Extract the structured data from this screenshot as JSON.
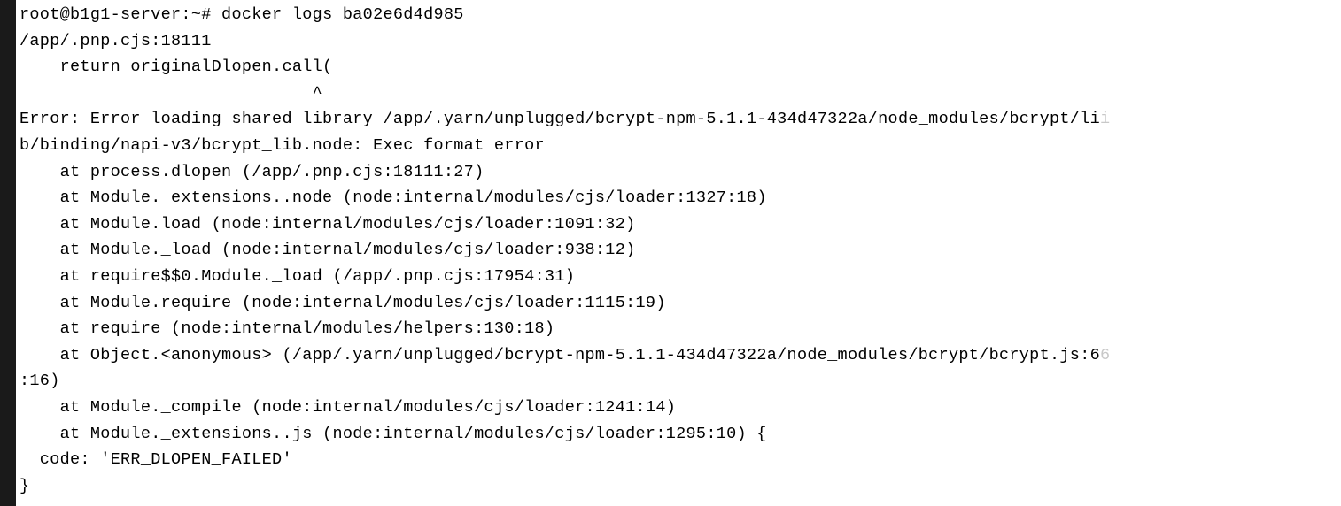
{
  "terminal": {
    "prompt": "root@b1g1-server:~# ",
    "command": "docker logs ba02e6d4d985",
    "lines": [
      "/app/.pnp.cjs:18111",
      "    return originalDlopen.call(",
      "                             ^",
      "",
      "Error: Error loading shared library /app/.yarn/unplugged/bcrypt-npm-5.1.1-434d47322a/node_modules/bcrypt/li",
      "b/binding/napi-v3/bcrypt_lib.node: Exec format error",
      "    at process.dlopen (/app/.pnp.cjs:18111:27)",
      "    at Module._extensions..node (node:internal/modules/cjs/loader:1327:18)",
      "    at Module.load (node:internal/modules/cjs/loader:1091:32)",
      "    at Module._load (node:internal/modules/cjs/loader:938:12)",
      "    at require$$0.Module._load (/app/.pnp.cjs:17954:31)",
      "    at Module.require (node:internal/modules/cjs/loader:1115:19)",
      "    at require (node:internal/modules/helpers:130:18)",
      "    at Object.<anonymous> (/app/.yarn/unplugged/bcrypt-npm-5.1.1-434d47322a/node_modules/bcrypt/bcrypt.js:6",
      ":16)",
      "    at Module._compile (node:internal/modules/cjs/loader:1241:14)",
      "    at Module._extensions..js (node:internal/modules/cjs/loader:1295:10) {",
      "  code: 'ERR_DLOPEN_FAILED'",
      "}"
    ],
    "faded_suffix_line_4": "i",
    "faded_suffix_line_13": "6"
  }
}
